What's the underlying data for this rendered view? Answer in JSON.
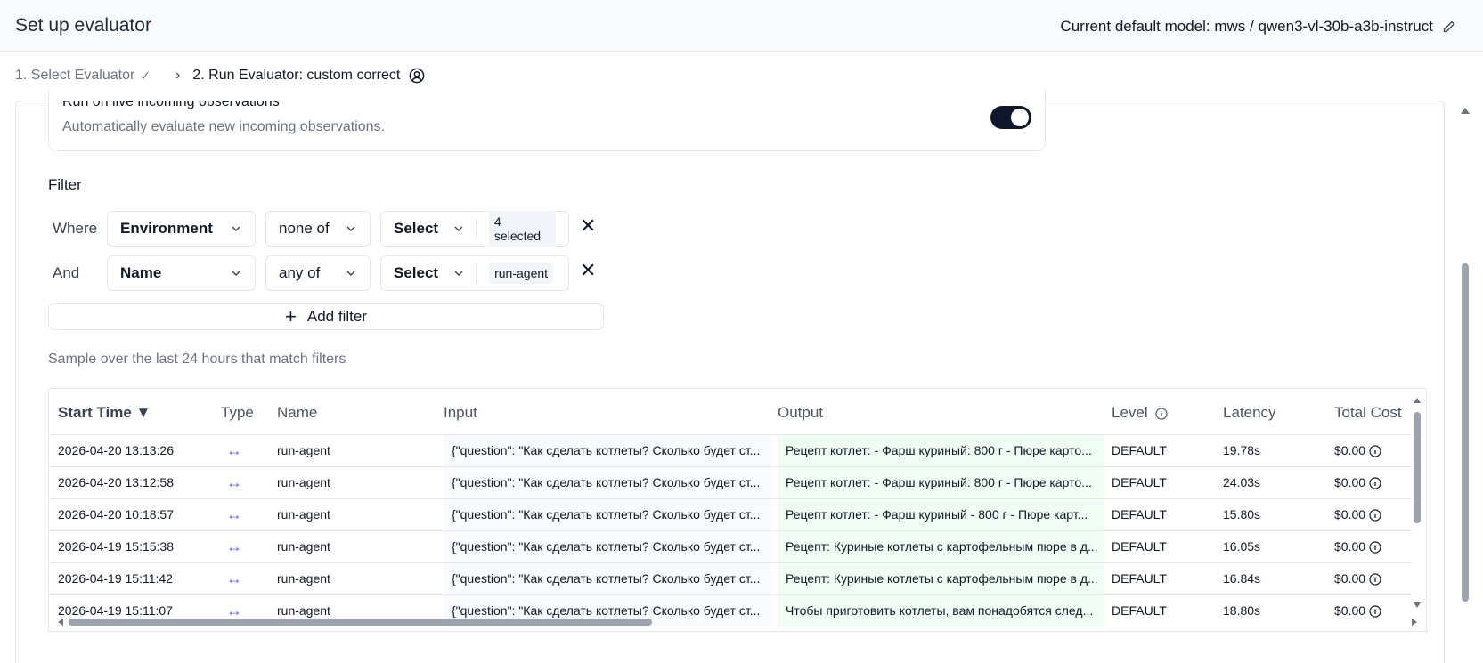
{
  "header": {
    "title": "Set up evaluator",
    "model_info": "Current default model: mws / qwen3-vl-30b-a3b-instruct"
  },
  "breadcrumbs": {
    "step1": "1. Select Evaluator",
    "step2": "2. Run Evaluator: custom correct"
  },
  "live": {
    "title": "Run on live incoming observations",
    "description": "Automatically evaluate new incoming observations.",
    "enabled": true
  },
  "filter": {
    "label": "Filter",
    "rows": [
      {
        "prefix": "Where",
        "column": "Environment",
        "operator": "none of",
        "value_label": "Select",
        "badge": "4 selected"
      },
      {
        "prefix": "And",
        "column": "Name",
        "operator": "any of",
        "value_label": "Select",
        "badge": "run-agent"
      }
    ],
    "add_label": "Add filter"
  },
  "sample_text": "Sample over the last 24 hours that match filters",
  "table": {
    "columns": {
      "start_time": "Start Time ▼",
      "type": "Type",
      "name": "Name",
      "input": "Input",
      "output": "Output",
      "level": "Level",
      "latency": "Latency",
      "total_cost": "Total Cost"
    },
    "rows": [
      {
        "start_time": "2026-04-20 13:13:26",
        "type": "↔",
        "name": "run-agent",
        "input": "{\"question\": \"Как сделать котлеты? Сколько будет ст...",
        "output": "Рецепт котлет: - Фарш куриный: 800 г - Пюре карто...",
        "level": "DEFAULT",
        "latency": "19.78s",
        "cost": "$0.00"
      },
      {
        "start_time": "2026-04-20 13:12:58",
        "type": "↔",
        "name": "run-agent",
        "input": "{\"question\": \"Как сделать котлеты? Сколько будет ст...",
        "output": "Рецепт котлет: - Фарш куриный: 800 г - Пюре карто...",
        "level": "DEFAULT",
        "latency": "24.03s",
        "cost": "$0.00"
      },
      {
        "start_time": "2026-04-20 10:18:57",
        "type": "↔",
        "name": "run-agent",
        "input": "{\"question\": \"Как сделать котлеты? Сколько будет ст...",
        "output": "Рецепт котлет: - Фарш куриный - 800 г - Пюре карт...",
        "level": "DEFAULT",
        "latency": "15.80s",
        "cost": "$0.00"
      },
      {
        "start_time": "2026-04-19 15:15:38",
        "type": "↔",
        "name": "run-agent",
        "input": "{\"question\": \"Как сделать котлеты? Сколько будет ст...",
        "output": "Рецепт: Куриные котлеты с картофельным пюре в д...",
        "level": "DEFAULT",
        "latency": "16.05s",
        "cost": "$0.00"
      },
      {
        "start_time": "2026-04-19 15:11:42",
        "type": "↔",
        "name": "run-agent",
        "input": "{\"question\": \"Как сделать котлеты? Сколько будет ст...",
        "output": "Рецепт: Куриные котлеты с картофельным пюре в д...",
        "level": "DEFAULT",
        "latency": "16.84s",
        "cost": "$0.00"
      },
      {
        "start_time": "2026-04-19 15:11:07",
        "type": "↔",
        "name": "run-agent",
        "input": "{\"question\": \"Как сделать котлеты? Сколько будет ст...",
        "output": "Чтобы приготовить котлеты, вам понадобятся след...",
        "level": "DEFAULT",
        "latency": "18.80s",
        "cost": "$0.00"
      }
    ]
  },
  "colors": {
    "toggle_on": "#0f172a",
    "type_icon": "#6366f1",
    "input_bg": "#f8fafc",
    "output_bg": "#f0fdf4"
  },
  "icons": {
    "edit": "pencil-icon",
    "user": "user-circle-icon",
    "check": "check-icon",
    "chevron": "chevron-down-icon",
    "close": "close-icon",
    "plus": "plus-icon",
    "info": "info-icon",
    "type": "arrows-horizontal-icon"
  }
}
